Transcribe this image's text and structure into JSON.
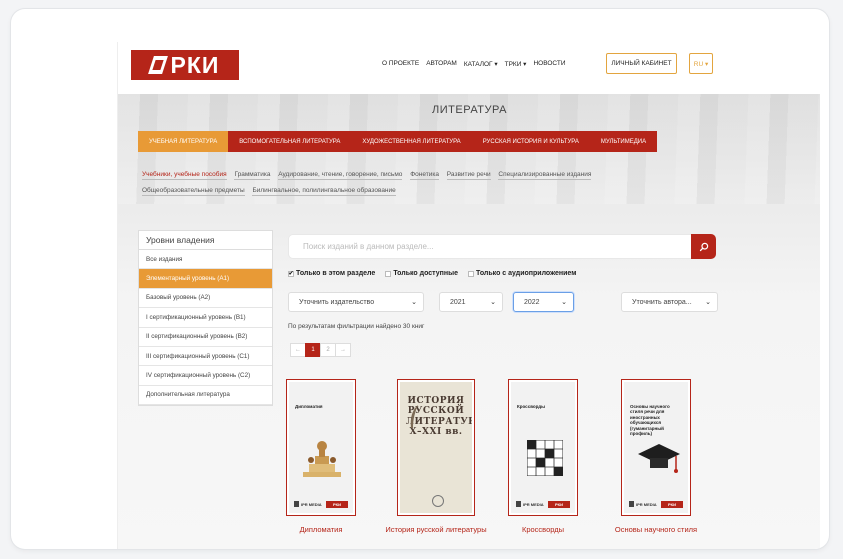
{
  "header": {
    "logo_text": "РКИ",
    "nav": [
      "О ПРОЕКТЕ",
      "АВТОРАМ",
      "КАТАЛОГ ▾",
      "ТРКИ ▾",
      "НОВОСТИ"
    ],
    "cabinet_label": "ЛИЧНЫЙ КАБИНЕТ",
    "lang_label": "RU ▾"
  },
  "hero": {
    "title": "ЛИТЕРАТУРА"
  },
  "tabs": [
    {
      "label": "УЧЕБНАЯ ЛИТЕРАТУРА",
      "active": true
    },
    {
      "label": "ВСПОМОГАТЕЛЬНАЯ ЛИТЕРАТУРА"
    },
    {
      "label": "ХУДОЖЕСТВЕННАЯ ЛИТЕРАТУРА"
    },
    {
      "label": "РУССКАЯ ИСТОРИЯ И КУЛЬТУРА"
    },
    {
      "label": "МУЛЬТИМЕДИА"
    }
  ],
  "subcategories": [
    "Учебники, учебные пособия",
    "Грамматика",
    "Аудирование, чтение, говорение, письмо",
    "Фонетика",
    "Развитие речи",
    "Специализированные издания",
    "Общеобразовательные предметы",
    "Билингвальное, полилингвальное образование"
  ],
  "sidebar": {
    "title": "Уровни владения",
    "items": [
      "Все издания",
      "Элементарный уровень (А1)",
      "Базовый уровень (А2)",
      "I сертификационный уровень (В1)",
      "II сертификационный уровень (В2)",
      "III сертификационный уровень (С1)",
      "IV сертификационный уровень (С2)",
      "Дополнительная литература"
    ]
  },
  "search": {
    "placeholder": "Поиск изданий в данном разделе..."
  },
  "filters": {
    "in_section": "Только в этом разделе",
    "available": "Только доступные",
    "audio": "Только с аудиоприложением"
  },
  "selects": {
    "publisher": "Уточнить издательство",
    "year_from": "2021",
    "year_to": "2022",
    "author": "Уточнить автора..."
  },
  "results_text": "По результатам фильтрации найдено 30 книг",
  "pagination": [
    "←",
    "1",
    "2",
    "→"
  ],
  "books": [
    {
      "title": "Дипломатия",
      "cover_title": "Дипломатия",
      "publisher": "IPR MEDIA",
      "badge": "РКИ"
    },
    {
      "title": "История русской литературы X–XXI вв.",
      "cover_title": "ИСТОРИЯ РУССКОЙ ЛИТЕРАТУРЫ X–XXI вв.",
      "publisher": "",
      "badge": ""
    },
    {
      "title": "Кроссворды",
      "cover_title": "Кроссворды",
      "publisher": "IPR MEDIA",
      "badge": "РКИ"
    },
    {
      "title": "Основы научного стиля",
      "cover_title": "Основы научного стиля речи для иностранных обучающихся (гуманитарный профиль)",
      "publisher": "IPR MEDIA",
      "badge": "РКИ"
    }
  ],
  "colors": {
    "brand_red": "#b52519",
    "accent_orange": "#e89a36"
  }
}
